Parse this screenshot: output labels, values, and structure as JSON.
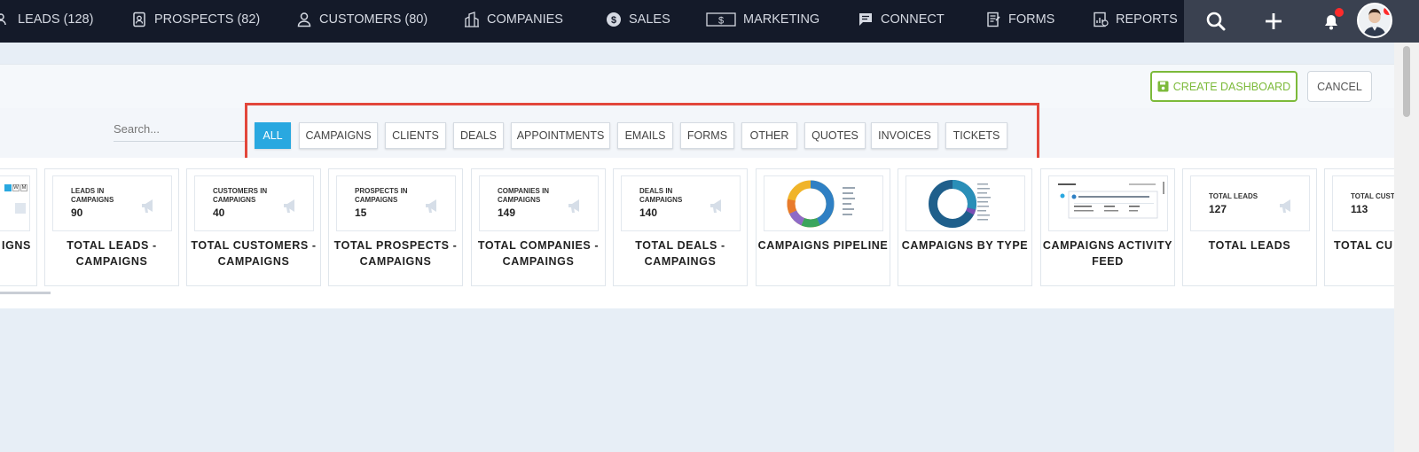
{
  "nav": {
    "items": [
      {
        "label": "LEADS (128)",
        "icon": "user-group-icon"
      },
      {
        "label": "PROSPECTS (82)",
        "icon": "id-badge-icon"
      },
      {
        "label": "CUSTOMERS (80)",
        "icon": "user-icon"
      },
      {
        "label": "COMPANIES",
        "icon": "building-icon"
      },
      {
        "label": "SALES",
        "icon": "dollar-circle-icon"
      },
      {
        "label": "MARKETING",
        "icon": "dollar-bill-icon"
      },
      {
        "label": "CONNECT",
        "icon": "chat-icon"
      },
      {
        "label": "FORMS",
        "icon": "form-icon"
      },
      {
        "label": "REPORTS",
        "icon": "report-icon"
      }
    ]
  },
  "header": {
    "create_label": "CREATE DASHBOARD",
    "cancel_label": "CANCEL"
  },
  "search": {
    "placeholder": "Search..."
  },
  "filters": {
    "active": "ALL",
    "tabs": [
      "ALL",
      "CAMPAIGNS",
      "CLIENTS",
      "DEALS",
      "APPOINTMENTS",
      "EMAILS",
      "FORMS",
      "OTHER",
      "QUOTES",
      "INVOICES",
      "TICKETS"
    ]
  },
  "cards": [
    {
      "title": "IGNS",
      "kind": "calendar"
    },
    {
      "title": "TOTAL LEADS - CAMPAIGNS",
      "thumb_label": "LEADS IN CAMPAIGNS",
      "thumb_value": "90",
      "kind": "stat"
    },
    {
      "title": "TOTAL CUSTOMERS - CAMPAIGNS",
      "thumb_label": "CUSTOMERS IN CAMPAIGNS",
      "thumb_value": "40",
      "kind": "stat"
    },
    {
      "title": "TOTAL PROSPECTS - CAMPAIGNS",
      "thumb_label": "PROSPECTS IN CAMPAIGNS",
      "thumb_value": "15",
      "kind": "stat"
    },
    {
      "title": "TOTAL COMPANIES - CAMPAINGS",
      "thumb_label": "COMPANIES IN CAMPAIGNS",
      "thumb_value": "149",
      "kind": "stat"
    },
    {
      "title": "TOTAL DEALS - CAMPAINGS",
      "thumb_label": "DEALS IN CAMPAIGNS",
      "thumb_value": "140",
      "kind": "stat"
    },
    {
      "title": "CAMPAIGNS PIPELINE",
      "kind": "donut"
    },
    {
      "title": "CAMPAIGNS BY TYPE",
      "kind": "donut2"
    },
    {
      "title": "CAMPAIGNS ACTIVITY FEED",
      "kind": "feed"
    },
    {
      "title": "TOTAL LEADS",
      "thumb_label": "TOTAL LEADS",
      "thumb_value": "127",
      "kind": "stat"
    },
    {
      "title": "TOTAL CU",
      "thumb_label": "TOTAL CUST",
      "thumb_value": "113",
      "kind": "stat"
    }
  ],
  "colors": {
    "nav_bg": "#141a29",
    "accent_blue": "#29a8e0",
    "create_green": "#7cba3a",
    "highlight_red": "#e2473b",
    "notification_red": "#ff2b2b"
  }
}
